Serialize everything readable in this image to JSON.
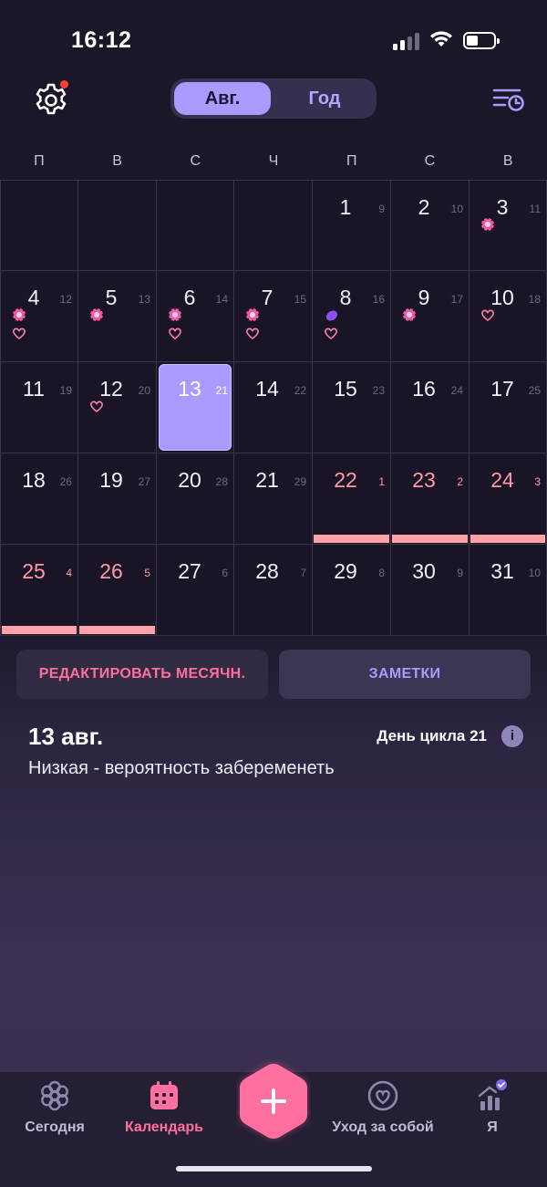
{
  "status_bar": {
    "time": "16:12"
  },
  "header": {
    "tabs": [
      {
        "label": "Авг.",
        "active": true
      },
      {
        "label": "Год",
        "active": false
      }
    ]
  },
  "weekdays": [
    "П",
    "В",
    "С",
    "Ч",
    "П",
    "С",
    "В"
  ],
  "calendar": {
    "weeks": [
      [
        null,
        null,
        null,
        null,
        {
          "day": "1",
          "cycle": "9"
        },
        {
          "day": "2",
          "cycle": "10"
        },
        {
          "day": "3",
          "cycle": "11",
          "icons": [
            "flower-icon"
          ]
        }
      ],
      [
        {
          "day": "4",
          "cycle": "12",
          "icons": [
            "flower-icon",
            "heart-icon"
          ]
        },
        {
          "day": "5",
          "cycle": "13",
          "icons": [
            "flower-icon"
          ]
        },
        {
          "day": "6",
          "cycle": "14",
          "icons": [
            "flower-icon",
            "heart-icon"
          ]
        },
        {
          "day": "7",
          "cycle": "15",
          "icons": [
            "flower-icon",
            "heart-icon"
          ]
        },
        {
          "day": "8",
          "cycle": "16",
          "icons": [
            "ovulation-icon",
            "heart-icon"
          ]
        },
        {
          "day": "9",
          "cycle": "17",
          "icons": [
            "flower-icon"
          ]
        },
        {
          "day": "10",
          "cycle": "18",
          "icons": [
            "heart-icon"
          ]
        }
      ],
      [
        {
          "day": "11",
          "cycle": "19"
        },
        {
          "day": "12",
          "cycle": "20",
          "icons": [
            "heart-icon"
          ]
        },
        {
          "day": "13",
          "cycle": "21",
          "today": true
        },
        {
          "day": "14",
          "cycle": "22"
        },
        {
          "day": "15",
          "cycle": "23"
        },
        {
          "day": "16",
          "cycle": "24"
        },
        {
          "day": "17",
          "cycle": "25"
        }
      ],
      [
        {
          "day": "18",
          "cycle": "26"
        },
        {
          "day": "19",
          "cycle": "27"
        },
        {
          "day": "20",
          "cycle": "28"
        },
        {
          "day": "21",
          "cycle": "29"
        },
        {
          "day": "22",
          "cycle": "1",
          "period": true
        },
        {
          "day": "23",
          "cycle": "2",
          "period": true
        },
        {
          "day": "24",
          "cycle": "3",
          "period": true
        }
      ],
      [
        {
          "day": "25",
          "cycle": "4",
          "period": true
        },
        {
          "day": "26",
          "cycle": "5",
          "period": true
        },
        {
          "day": "27",
          "cycle": "6"
        },
        {
          "day": "28",
          "cycle": "7"
        },
        {
          "day": "29",
          "cycle": "8"
        },
        {
          "day": "30",
          "cycle": "9"
        },
        {
          "day": "31",
          "cycle": "10"
        }
      ]
    ]
  },
  "actions": {
    "edit_period": "РЕДАКТИРОВАТЬ МЕСЯЧН.",
    "notes": "ЗАМЕТКИ"
  },
  "details": {
    "date": "13 авг.",
    "cycle_day": "День цикла 21",
    "info_icon": "i",
    "probability": "Низкая - вероятность забеременеть"
  },
  "tab_bar": [
    {
      "label": "Сегодня",
      "icon": "today-icon",
      "active": false
    },
    {
      "label": "Календарь",
      "icon": "calendar-icon",
      "active": true
    },
    {
      "label": "Уход за собой",
      "icon": "self-care-icon",
      "active": false
    },
    {
      "label": "Я",
      "icon": "profile-icon",
      "active": false
    }
  ],
  "colors": {
    "accent": "#a99bff",
    "pink": "#ff6fa0",
    "period": "#ffa3a8",
    "background": "#1a1526"
  }
}
